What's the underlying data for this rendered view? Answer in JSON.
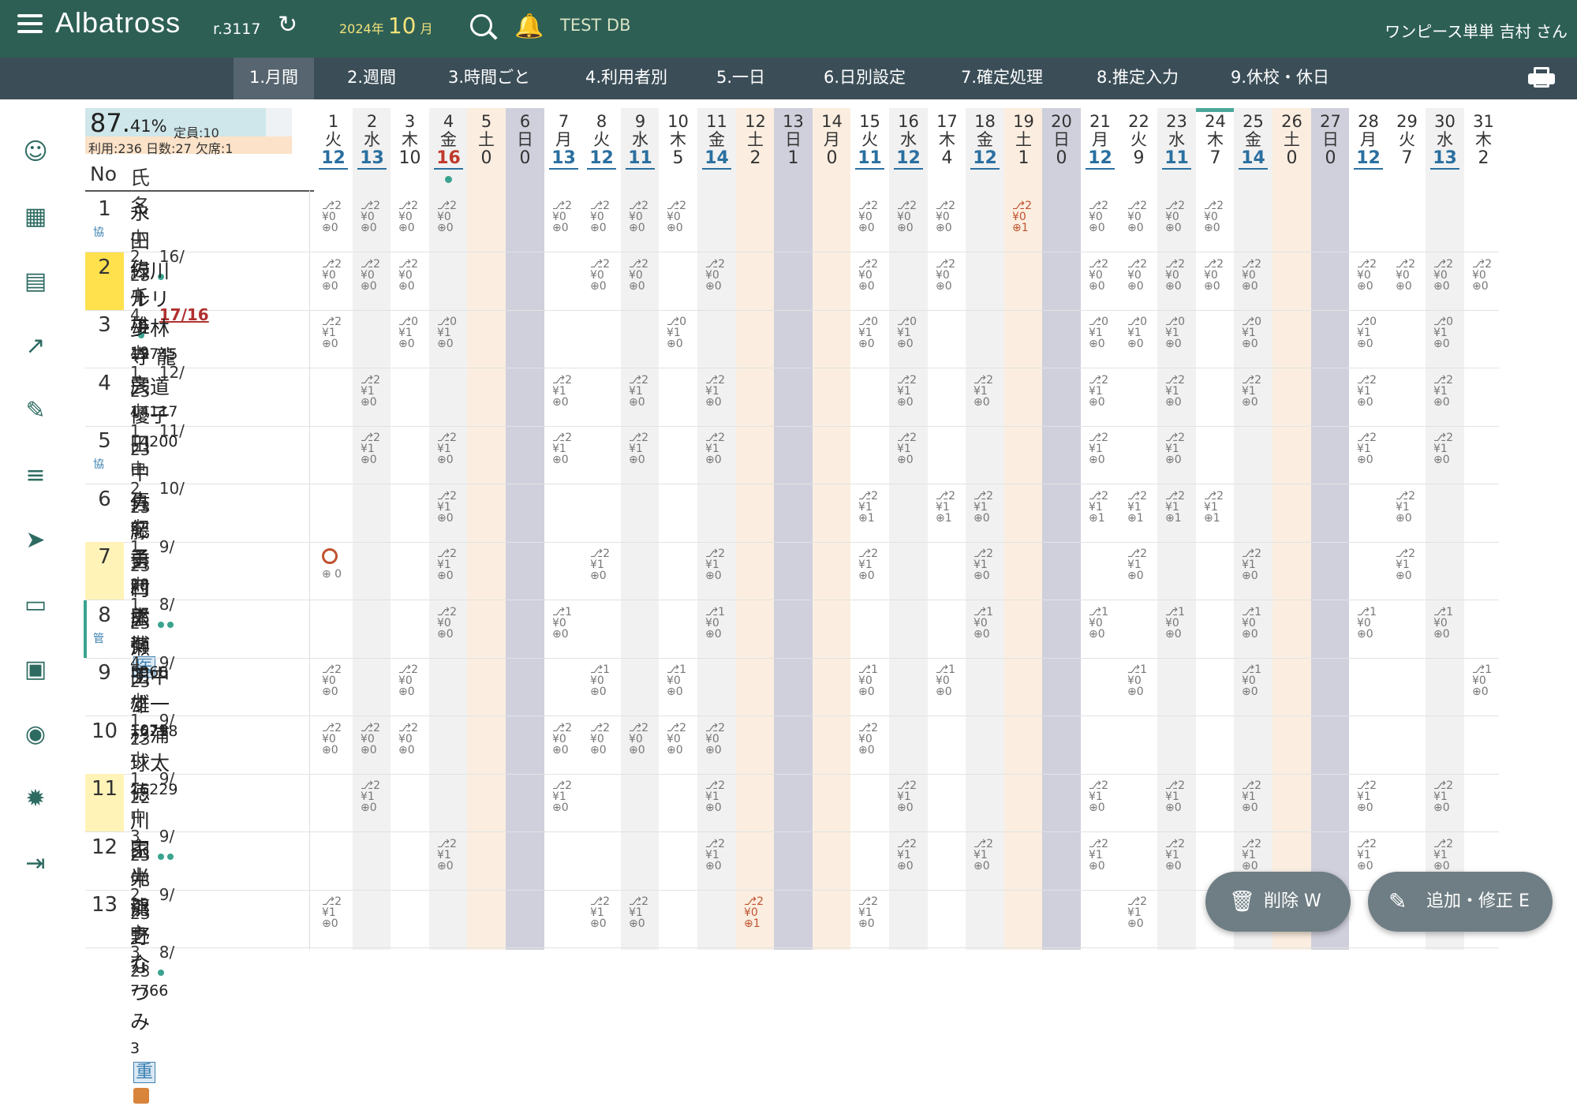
{
  "header": {
    "app_title": "Albatross",
    "revision": "r.3117",
    "year_label": "2024年",
    "month_number": "10",
    "month_suffix": "月",
    "db_label": "TEST DB",
    "user_label": "ワンピース単単 吉村 さん"
  },
  "tabs": [
    {
      "label": "1.月間",
      "active": true
    },
    {
      "label": "2.週間"
    },
    {
      "label": "3.時間ごと"
    },
    {
      "label": "4.利用者別"
    },
    {
      "label": "5.一日"
    },
    {
      "label": "6.日別設定"
    },
    {
      "label": "7.確定処理"
    },
    {
      "label": "8.推定入力"
    },
    {
      "label": "9.休校・休日"
    }
  ],
  "summary": {
    "rate_main": "87.",
    "rate_decimal": "41%",
    "capacity": "定員:10",
    "stats": "利用:236 日数:27 欠席:1",
    "rate_fill": 0.874
  },
  "table_headers": {
    "no": "No",
    "name": "氏名"
  },
  "days": [
    {
      "d": "1",
      "w": "火",
      "c": "12",
      "u": true,
      "t": "w"
    },
    {
      "d": "2",
      "w": "水",
      "c": "13",
      "u": true,
      "t": "g"
    },
    {
      "d": "3",
      "w": "木",
      "c": "10",
      "t": "w"
    },
    {
      "d": "4",
      "w": "金",
      "c": "16",
      "u": true,
      "red": true,
      "dot": true,
      "t": "g"
    },
    {
      "d": "5",
      "w": "土",
      "c": "0",
      "t": "s"
    },
    {
      "d": "6",
      "w": "日",
      "c": "0",
      "t": "h"
    },
    {
      "d": "7",
      "w": "月",
      "c": "13",
      "u": true,
      "t": "w"
    },
    {
      "d": "8",
      "w": "火",
      "c": "12",
      "u": true,
      "t": "w"
    },
    {
      "d": "9",
      "w": "水",
      "c": "11",
      "u": true,
      "t": "g"
    },
    {
      "d": "10",
      "w": "木",
      "c": "5",
      "t": "w"
    },
    {
      "d": "11",
      "w": "金",
      "c": "14",
      "u": true,
      "t": "g"
    },
    {
      "d": "12",
      "w": "土",
      "c": "2",
      "t": "s"
    },
    {
      "d": "13",
      "w": "日",
      "c": "1",
      "t": "h"
    },
    {
      "d": "14",
      "w": "月",
      "c": "0",
      "t": "s"
    },
    {
      "d": "15",
      "w": "火",
      "c": "11",
      "u": true,
      "t": "w"
    },
    {
      "d": "16",
      "w": "水",
      "c": "12",
      "u": true,
      "t": "g"
    },
    {
      "d": "17",
      "w": "木",
      "c": "4",
      "t": "w"
    },
    {
      "d": "18",
      "w": "金",
      "c": "12",
      "u": true,
      "t": "g"
    },
    {
      "d": "19",
      "w": "土",
      "c": "1",
      "t": "s"
    },
    {
      "d": "20",
      "w": "日",
      "c": "0",
      "t": "h"
    },
    {
      "d": "21",
      "w": "月",
      "c": "12",
      "u": true,
      "t": "w"
    },
    {
      "d": "22",
      "w": "火",
      "c": "9",
      "t": "w"
    },
    {
      "d": "23",
      "w": "水",
      "c": "11",
      "u": true,
      "t": "g"
    },
    {
      "d": "24",
      "w": "木",
      "c": "7",
      "today": true,
      "t": "w"
    },
    {
      "d": "25",
      "w": "金",
      "c": "14",
      "u": true,
      "t": "g"
    },
    {
      "d": "26",
      "w": "土",
      "c": "0",
      "t": "s"
    },
    {
      "d": "27",
      "w": "日",
      "c": "0",
      "t": "h"
    },
    {
      "d": "28",
      "w": "月",
      "c": "12",
      "u": true,
      "t": "w"
    },
    {
      "d": "29",
      "w": "火",
      "c": "7",
      "t": "w"
    },
    {
      "d": "30",
      "w": "水",
      "c": "13",
      "u": true,
      "t": "g"
    },
    {
      "d": "31",
      "w": "木",
      "c": "2",
      "t": "w"
    }
  ],
  "rows": [
    {
      "no": "1",
      "name": "永田 佐千雄",
      "id": "19",
      "tag": "協",
      "grade": "小2",
      "usage": "16/ 23",
      "dots": 1,
      "cells": {
        "1": "2,0,0",
        "2": "2,0,0",
        "3": "2,0,0",
        "4": "2,0,0",
        "7": "2,0,0",
        "8": "2,0,0",
        "9": "2,0,0",
        "10": "2,0,0",
        "15": "2,0,0",
        "16": "2,0,0",
        "17": "2,0,0",
        "19": "r2,0,1",
        "21": "2,0,0",
        "22": "2,0,0",
        "23": "2,0,0",
        "24": "2,0,0"
      }
    },
    {
      "no": "2",
      "name": "緑川 ルリ子",
      "id": "13745",
      "hl": true,
      "grade": "小4",
      "usage": "17/16",
      "usage_red": true,
      "dots": 1,
      "cells": {
        "1": "2,0,0",
        "2": "2,0,0",
        "3": "2,0,0",
        "8": "2,0,0",
        "9": "2,0,0",
        "11": "2,0,0",
        "15": "2,0,0",
        "17": "2,0,0",
        "21": "2,0,0",
        "22": "2,0,0",
        "23": "2,0,0",
        "24": "2,0,0",
        "25": "2,0,0",
        "28": "2,0,0",
        "29": "2,0,0",
        "30": "2,0,0",
        "31": "2,0,0"
      }
    },
    {
      "no": "3",
      "name": "少林寺 龍彦",
      "id": "14117",
      "grade": "小1",
      "usage": "12/ 23",
      "cells": {
        "1": "2,1,0",
        "3": "0,1,0",
        "4": "0,1,0",
        "10": "0,1,0",
        "15": "0,1,0",
        "16": "0,1,0",
        "21": "0,1,0",
        "22": "0,1,0",
        "23": "0,1,0",
        "25": "0,1,0",
        "28": "0,1,0",
        "30": "0,1,0"
      }
    },
    {
      "no": "4",
      "name": "宍道 優子",
      "id": "14200",
      "grade": "小1",
      "usage": "11/ 23",
      "cells": {
        "2": "2,1,0",
        "7": "2,1,0",
        "9": "2,1,0",
        "11": "2,1,0",
        "16": "2,1,0",
        "18": "2,1,0",
        "21": "2,1,0",
        "23": "2,1,0",
        "25": "2,1,0",
        "28": "2,1,0",
        "30": "2,1,0"
      }
    },
    {
      "no": "5",
      "name": "田中 真紀子",
      "id": "28",
      "tag": "協",
      "grade": "中2",
      "usage": "10/ 23",
      "cells": {
        "2": "2,1,0",
        "4": "2,1,0",
        "7": "2,1,0",
        "9": "2,1,0",
        "11": "2,1,0",
        "16": "2,1,0",
        "21": "2,1,0",
        "23": "2,1,0",
        "28": "2,1,0",
        "30": "2,1,0"
      }
    },
    {
      "no": "6",
      "name": "佐藤 勇四郎",
      "id": "2",
      "badge": "医",
      "grade": "中1",
      "usage": "9/ 23",
      "cells": {
        "4": "2,1,0",
        "15": "2,1,1",
        "17": "2,1,1",
        "18": "2,1,0",
        "21": "2,1,1",
        "22": "2,1,1",
        "23": "2,1,1",
        "24": "2,1,1",
        "29": "2,1,0"
      }
    },
    {
      "no": "7",
      "name": "吉村 幸博",
      "id": "5968",
      "hl": true,
      "grade": "中1",
      "usage": "8/ 23",
      "dots": 2,
      "cells": {
        "1": "ban",
        "4": "2,1,0",
        "8": "2,1,0",
        "11": "2,1,0",
        "15": "2,1,0",
        "18": "2,1,0",
        "22": "2,1,0",
        "25": "2,1,0",
        "29": "2,1,0"
      }
    },
    {
      "no": "8",
      "name": "広瀬 すず",
      "id": "1079",
      "tag": "管",
      "bar": true,
      "grade": "小4",
      "usage": "9/ 23",
      "cells": {
        "4": "2,0,0",
        "7": "1,0,0",
        "11": "1,0,0",
        "18": "1,0,0",
        "21": "1,0,0",
        "23": "1,0,0",
        "25": "1,0,0",
        "28": "1,0,0",
        "30": "1,0,0"
      }
    },
    {
      "no": "9",
      "name": "田中 雄一",
      "id": "16218",
      "grade": "小1",
      "usage": "9/ 23",
      "cells": {
        "1": "2,0,0",
        "3": "2,0,0",
        "8": "1,0,0",
        "10": "1,0,0",
        "15": "1,0,0",
        "17": "1,0,0",
        "22": "1,0,0",
        "25": "1,0,0",
        "31": "1,0,0"
      }
    },
    {
      "no": "10",
      "name": "杉浦 球太",
      "id": "16229",
      "grade": "小1",
      "usage": "9/ 22",
      "cells": {
        "1": "2,0,0",
        "2": "2,0,0",
        "3": "2,0,0",
        "7": "2,0,0",
        "8": "2,0,0",
        "9": "2,0,0",
        "10": "2,0,0",
        "11": "2,0,0",
        "15": "2,0,0"
      }
    },
    {
      "no": "11",
      "name": "徳川 家光",
      "id": "29",
      "hl": true,
      "grade": "中3",
      "usage": "9/ 23",
      "dots": 2,
      "cells": {
        "2": "2,1,0",
        "7": "2,1,0",
        "11": "2,1,0",
        "16": "2,1,0",
        "21": "2,1,0",
        "23": "2,1,0",
        "25": "2,1,0",
        "28": "2,1,0",
        "30": "2,1,0"
      }
    },
    {
      "no": "12",
      "name": "田中 龍之介",
      "id": "7766",
      "grade": "小2",
      "usage": "9/ 23",
      "cells": {
        "4": "2,1,0",
        "11": "2,1,0",
        "16": "2,1,0",
        "18": "2,1,0",
        "21": "2,1,0",
        "23": "2,1,0",
        "25": "2,1,0",
        "28": "2,1,0",
        "30": "2,1,0"
      }
    },
    {
      "no": "13",
      "name": "浜野 なつみ",
      "id": "3",
      "badge": "重",
      "gift": true,
      "grade": "中3",
      "usage": "8/ 23",
      "dots": 1,
      "cells": {
        "1": "2,1,0",
        "8": "2,1,0",
        "9": "2,1,0",
        "12": "r2,0,1",
        "15": "2,1,0",
        "22": "2,1,0"
      }
    }
  ],
  "actions": {
    "delete_label": "削除 W",
    "add_label": "追加・修正 E"
  },
  "side_icons": [
    "smile-icon",
    "calendar-icon",
    "document-icon",
    "trend-icon",
    "edit-icon",
    "sliders-icon",
    "send-icon",
    "book-icon",
    "event-icon",
    "account-icon",
    "bug-icon",
    "logout-icon"
  ],
  "colors": {
    "header": "#2d5f55",
    "tabbar": "#3b4e58",
    "saturday": "#fbeee0",
    "holiday": "#cfd0dc",
    "gray": "#f1f1f1",
    "accent": "#2a6fa0"
  }
}
